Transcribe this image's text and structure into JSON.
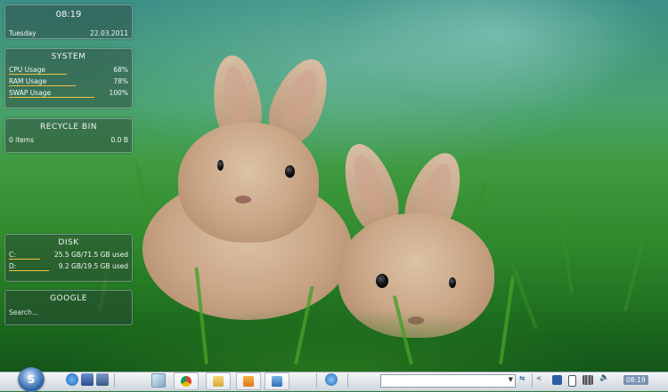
{
  "clock": {
    "time": "08:19",
    "day": "Tuesday",
    "date": "22.03.2011"
  },
  "system": {
    "title": "SYSTEM",
    "rows": [
      {
        "label": "CPU Usage",
        "value": "68%",
        "level": 0.68
      },
      {
        "label": "RAM Usage",
        "value": "78%",
        "level": 0.78
      },
      {
        "label": "SWAP Usage",
        "value": "100%",
        "level": 1.0
      }
    ]
  },
  "recycle_bin": {
    "title": "RECYCLE BIN",
    "items": "0 items",
    "size": "0.0 B"
  },
  "disk": {
    "title": "DISK",
    "rows": [
      {
        "label": "C:",
        "value": "25.5 GB/71.5 GB used",
        "level": 0.36
      },
      {
        "label": "D:",
        "value": "9.2 GB/19.5 GB used",
        "level": 0.47
      }
    ]
  },
  "google": {
    "title": "GOOGLE",
    "placeholder": "Search..."
  },
  "taskbar": {
    "address_value": "",
    "tray_time": "08:19",
    "chevron": "<"
  },
  "colors": {
    "bar": "#f0c040",
    "taskbar": "#e1e5ea"
  }
}
